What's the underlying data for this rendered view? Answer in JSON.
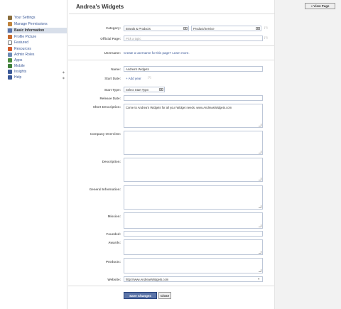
{
  "sidebar": {
    "items": [
      {
        "label": "Your Settings",
        "icon": "settings-icon",
        "color": "#8a6d3b"
      },
      {
        "label": "Manage Permissions",
        "icon": "permissions-icon",
        "color": "#c0833c"
      },
      {
        "label": "Basic Information",
        "icon": "info-icon",
        "color": "#5b74a8"
      },
      {
        "label": "Profile Picture",
        "icon": "picture-icon",
        "color": "#c86a2c"
      },
      {
        "label": "Featured",
        "icon": "star-icon",
        "color": "#777777"
      },
      {
        "label": "Resources",
        "icon": "resources-icon",
        "color": "#d45c2a"
      },
      {
        "label": "Admin Roles",
        "icon": "admin-icon",
        "color": "#6d8bb4"
      },
      {
        "label": "Apps",
        "icon": "apps-icon",
        "color": "#4a8b3f"
      },
      {
        "label": "Mobile",
        "icon": "mobile-icon",
        "color": "#3e7f3a"
      },
      {
        "label": "Insights",
        "icon": "insights-icon",
        "color": "#3b5998"
      },
      {
        "label": "Help",
        "icon": "help-icon",
        "color": "#3b5998"
      }
    ]
  },
  "header": {
    "title": "Andrea's Widgets",
    "view_page": "« View Page"
  },
  "form": {
    "category_label": "Category:",
    "category_value": "Brands & Products",
    "subcategory_value": "Product/Service",
    "official_page_label": "Official Page:",
    "official_page_placeholder": "Pick a topic",
    "help_hint": "[?]",
    "username_label": "Username:",
    "username_link": "Create a username for this page?",
    "learn_more": "Learn more.",
    "name_label": "Name:",
    "name_value": "Andrea's Widgets",
    "start_date_label": "Start Date:",
    "add_year": "+ Add year",
    "start_type_label": "Start Type:",
    "start_type_value": "Select Start Type:",
    "release_date_label": "Release Date:",
    "short_desc_label": "Short Description:",
    "short_desc_value": "Come to Andrea's Widgets for all your Widget needs.  www.AndreasWidgets.com",
    "company_overview_label": "Company Overview:",
    "description_label": "Description:",
    "general_info_label": "General Information:",
    "mission_label": "Mission:",
    "founded_label": "Founded:",
    "awards_label": "Awards:",
    "products_label": "Products:",
    "website_label": "Website:",
    "website_value": "http://www.AndreasWidgets.com",
    "save_button": "Save Changes",
    "close_button": "Close"
  }
}
